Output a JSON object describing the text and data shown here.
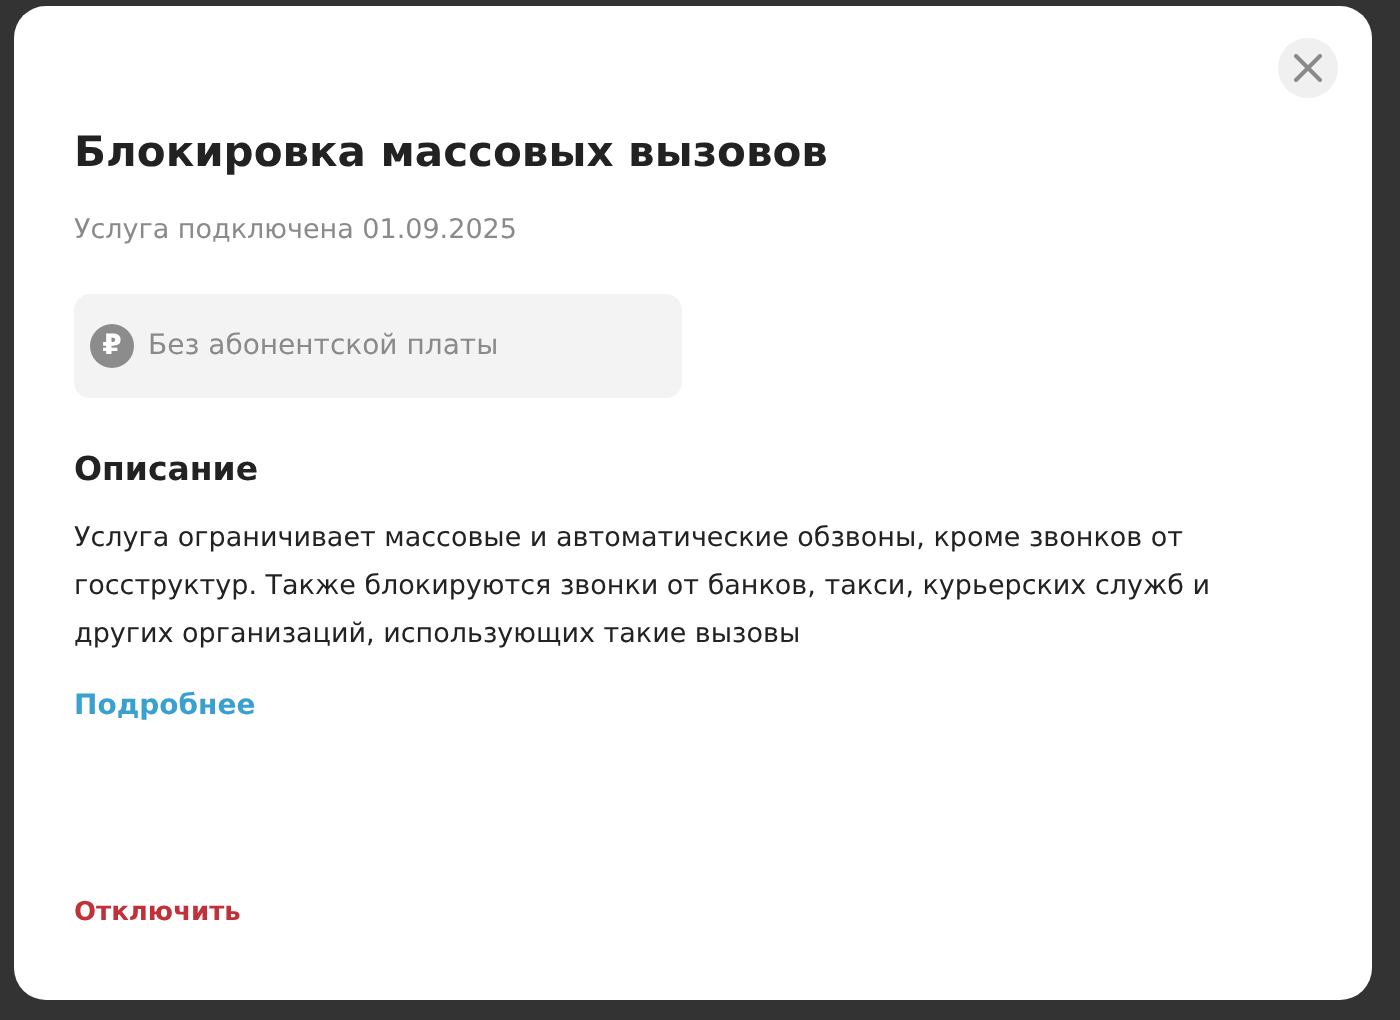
{
  "dialog": {
    "title": "Блокировка массовых вызовов",
    "subtitle": "Услуга подключена 01.09.2025",
    "price_chip": {
      "currency_icon": "₽",
      "label": "Без абонентской платы"
    },
    "description": {
      "heading": "Описание",
      "text": "Услуга ограничивает массовые и автоматические обзвоны, кроме звонков от госструктур. Также блокируются звонки от банков, такси, курьерских служб и других организаций, использующих такие вызовы"
    },
    "more_link": "Подробнее",
    "disable_button": "Отключить"
  }
}
